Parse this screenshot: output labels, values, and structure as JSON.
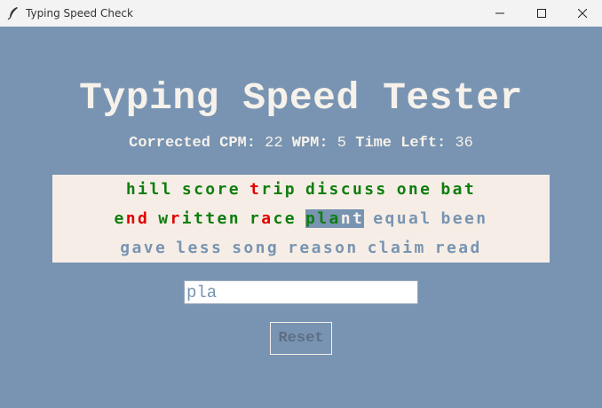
{
  "window": {
    "title": "Typing Speed Check",
    "icon": "feather-icon"
  },
  "heading": "Typing Speed Tester",
  "stats": {
    "cpm_label": "Corrected CPM:",
    "cpm_value": "22",
    "wpm_label": "WPM:",
    "wpm_value": "5",
    "time_label": "Time Left:",
    "time_value": "36"
  },
  "words": {
    "lines": [
      [
        {
          "text": "hill",
          "state": "correct"
        },
        {
          "text": "score",
          "state": "correct"
        },
        {
          "text": "trip",
          "state": "mixed",
          "chars": [
            "wrong",
            "correct",
            "correct",
            "correct"
          ]
        },
        {
          "text": "discuss",
          "state": "correct"
        },
        {
          "text": "one",
          "state": "correct"
        },
        {
          "text": "bat",
          "state": "correct"
        }
      ],
      [
        {
          "text": "end",
          "state": "mixed",
          "chars": [
            "correct",
            "wrong",
            "wrong"
          ]
        },
        {
          "text": "written",
          "state": "mixed",
          "chars": [
            "correct",
            "wrong",
            "correct",
            "correct",
            "correct",
            "correct",
            "correct"
          ]
        },
        {
          "text": "race",
          "state": "mixed",
          "chars": [
            "correct",
            "wrong",
            "correct",
            "correct"
          ]
        },
        {
          "text": "plant",
          "state": "current",
          "chars": [
            "correct",
            "correct",
            "correct",
            "pending",
            "pending"
          ]
        },
        {
          "text": "equal",
          "state": "pending"
        },
        {
          "text": "been",
          "state": "pending"
        }
      ],
      [
        {
          "text": "gave",
          "state": "pending"
        },
        {
          "text": "less",
          "state": "pending"
        },
        {
          "text": "song",
          "state": "pending"
        },
        {
          "text": "reason",
          "state": "pending"
        },
        {
          "text": "claim",
          "state": "pending"
        },
        {
          "text": "read",
          "state": "pending"
        }
      ]
    ]
  },
  "input": {
    "value": "pla"
  },
  "reset_label": "Reset",
  "colors": {
    "background": "#7894b2",
    "correct": "#0f7d0f",
    "wrong": "#e00000",
    "panel": "#f6eee6"
  }
}
